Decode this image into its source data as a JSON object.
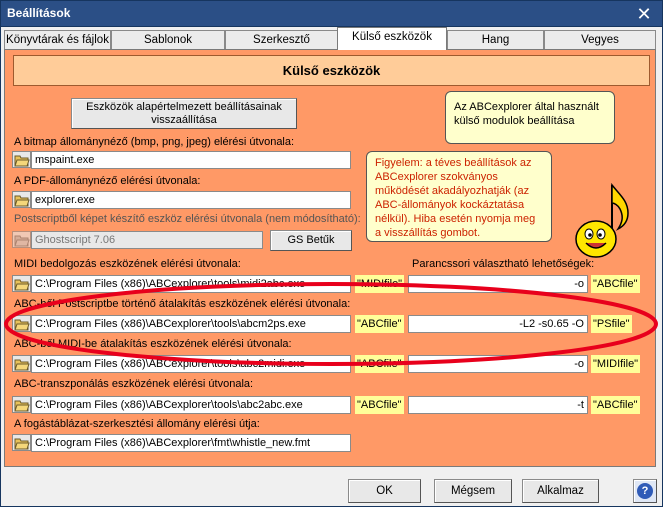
{
  "window": {
    "title": "Beállítások",
    "close_glyph": "✕"
  },
  "tabs": [
    {
      "label": "Könyvtárak és fájlok"
    },
    {
      "label": "Sablonok"
    },
    {
      "label": "Szerkesztő"
    },
    {
      "label": "Külső eszközök"
    },
    {
      "label": "Hang"
    },
    {
      "label": "Vegyes"
    }
  ],
  "page": {
    "header": "Külső eszközök",
    "reset_button": "Eszközök alapértelmezett beállításainak visszaállítása",
    "tip_info": "Az ABCexplorer által használt külső modulok beállítása",
    "tip_warning": "Figyelem: a téves beállítások az ABCexplorer szokványos működését akadályozhatják (az ABC-állományok kockáztatása nélkül). Hiba esetén nyomja meg a visszállítás gombot.",
    "bitmap": {
      "label": "A bitmap állománynéző (bmp, png, jpeg) elérési útvonala:",
      "value": "mspaint.exe"
    },
    "pdf": {
      "label": "A PDF-állománynéző elérési útvonala:",
      "value": "explorer.exe"
    },
    "ps": {
      "label": "Postscriptből képet készítő eszköz elérési útvonala (nem módosítható):",
      "value": "Ghostscript 7.06",
      "button": "GS Betűk"
    },
    "options_label": "Parancssori választható lehetőségek:",
    "midi_in": {
      "label": "MIDI bedolgozás eszközének elérési útvonala:",
      "value": "C:\\Program Files (x86)\\ABCexplorer\\tools\\midi2abc.exe",
      "tag_in": "\"MIDIfile\"",
      "option": "-o",
      "tag_out": "\"ABCfile\""
    },
    "abc2ps": {
      "label": "ABC-ből Postscriptbe történő átalakítás eszközének elérési útvonala:",
      "value": "C:\\Program Files (x86)\\ABCexplorer\\tools\\abcm2ps.exe",
      "tag_in": "\"ABCfile\"",
      "option": "-L2 -s0.65 -O",
      "tag_out": "\"PSfile\""
    },
    "abc2midi": {
      "label": "ABC-ből MIDI-be átalakítás eszközének elérési útvonala:",
      "value": "C:\\Program Files (x86)\\ABCexplorer\\tools\\abc2midi.exe",
      "tag_in": "\"ABCfile\"",
      "option": "-o",
      "tag_out": "\"MIDIfile\""
    },
    "transpose": {
      "label": "ABC-transzponálás eszközének elérési útvonala:",
      "value": "C:\\Program Files (x86)\\ABCexplorer\\tools\\abc2abc.exe",
      "tag_in": "\"ABCfile\"",
      "option": "-t",
      "tag_out": "\"ABCfile\""
    },
    "fingering": {
      "label": "A fogástáblázat-szerkesztési állomány elérési útja:",
      "value": "C:\\Program Files (x86)\\ABCexplorer\\fmt\\whistle_new.fmt"
    }
  },
  "buttons": {
    "ok": "OK",
    "cancel": "Mégsem",
    "apply": "Alkalmaz",
    "help_glyph": "?"
  },
  "colors": {
    "title_bar": "#2b4f86",
    "page_bg": "#ff9966",
    "header_bg": "#ffcc99",
    "tag_bg": "#ffff99",
    "tip_bg": "#ffffcc",
    "highlight_ellipse": "#e8001c"
  }
}
